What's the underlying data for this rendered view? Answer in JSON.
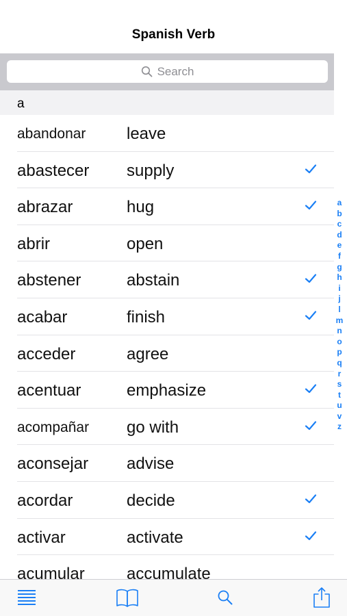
{
  "nav": {
    "title": "Spanish Verb"
  },
  "search": {
    "placeholder": "Search"
  },
  "section": {
    "header": "a"
  },
  "rows": [
    {
      "verb": "abandonar",
      "meaning": "leave",
      "checked": false,
      "small": true
    },
    {
      "verb": "abastecer",
      "meaning": "supply",
      "checked": true,
      "small": false
    },
    {
      "verb": "abrazar",
      "meaning": "hug",
      "checked": true,
      "small": false
    },
    {
      "verb": "abrir",
      "meaning": "open",
      "checked": false,
      "small": false
    },
    {
      "verb": "abstener",
      "meaning": "abstain",
      "checked": true,
      "small": false
    },
    {
      "verb": "acabar",
      "meaning": "finish",
      "checked": true,
      "small": false
    },
    {
      "verb": "acceder",
      "meaning": "agree",
      "checked": false,
      "small": false
    },
    {
      "verb": "acentuar",
      "meaning": "emphasize",
      "checked": true,
      "small": false
    },
    {
      "verb": "acompañar",
      "meaning": "go with",
      "checked": true,
      "small": true
    },
    {
      "verb": "aconsejar",
      "meaning": "advise",
      "checked": false,
      "small": false
    },
    {
      "verb": "acordar",
      "meaning": "decide",
      "checked": true,
      "small": false
    },
    {
      "verb": "activar",
      "meaning": "activate",
      "checked": true,
      "small": false
    },
    {
      "verb": "acumular",
      "meaning": "accumulate",
      "checked": false,
      "small": false
    }
  ],
  "index_letters": [
    "a",
    "b",
    "c",
    "d",
    "e",
    "f",
    "g",
    "h",
    "i",
    "j",
    "l",
    "m",
    "n",
    "o",
    "p",
    "q",
    "r",
    "s",
    "t",
    "u",
    "v",
    "z"
  ],
  "tabs": [
    {
      "icon": "list-icon"
    },
    {
      "icon": "book-icon"
    },
    {
      "icon": "search-icon"
    },
    {
      "icon": "share-icon"
    }
  ],
  "colors": {
    "accent": "#1a7ff5",
    "search_bar_bg": "#c9c9ce",
    "section_bg": "#f2f2f4"
  }
}
